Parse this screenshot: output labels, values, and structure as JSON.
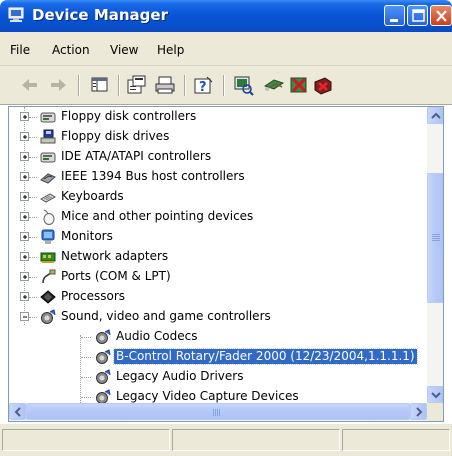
{
  "window": {
    "title": "Device Manager",
    "title_icon": "device-manager-icon",
    "controls": [
      "minimize-icon",
      "maximize-icon",
      "close-icon"
    ]
  },
  "menu": {
    "items": [
      "File",
      "Action",
      "View",
      "Help"
    ]
  },
  "toolbar": {
    "buttons": [
      "back-arrow-icon",
      "forward-arrow-icon",
      "console-tree-icon",
      "properties-icon",
      "print-icon",
      "help-icon",
      "scan-hardware-icon",
      "update-driver-icon",
      "uninstall-icon",
      "disable-icon"
    ]
  },
  "tree": {
    "items": [
      {
        "label": "Floppy disk controllers",
        "icon": "controller-icon",
        "expanded": false
      },
      {
        "label": "Floppy disk drives",
        "icon": "floppy-drive-icon",
        "expanded": false
      },
      {
        "label": "IDE ATA/ATAPI controllers",
        "icon": "controller-icon",
        "expanded": false
      },
      {
        "label": "IEEE 1394 Bus host controllers",
        "icon": "firewire-icon",
        "expanded": false
      },
      {
        "label": "Keyboards",
        "icon": "keyboard-icon",
        "expanded": false
      },
      {
        "label": "Mice and other pointing devices",
        "icon": "mouse-icon",
        "expanded": false
      },
      {
        "label": "Monitors",
        "icon": "monitor-icon",
        "expanded": false
      },
      {
        "label": "Network adapters",
        "icon": "network-adapter-icon",
        "expanded": false
      },
      {
        "label": "Ports (COM & LPT)",
        "icon": "port-icon",
        "expanded": false
      },
      {
        "label": "Processors",
        "icon": "processor-icon",
        "expanded": false
      },
      {
        "label": "Sound, video and game controllers",
        "icon": "sound-icon",
        "expanded": true
      },
      {
        "label": "Audio Codecs",
        "icon": "audio-device-icon",
        "child": true
      },
      {
        "label": "B-Control Rotary/Fader 2000 (12/23/2004,1.1.1.1)",
        "icon": "audio-device-icon",
        "child": true,
        "selected": true
      },
      {
        "label": "Legacy Audio Drivers",
        "icon": "audio-device-icon",
        "child": true
      },
      {
        "label": "Legacy Video Capture Devices",
        "icon": "audio-device-icon",
        "child": true
      }
    ]
  },
  "colors": {
    "titlebar": "#0a56d8",
    "selection": "#316ac5",
    "chrome": "#ece9d8"
  }
}
